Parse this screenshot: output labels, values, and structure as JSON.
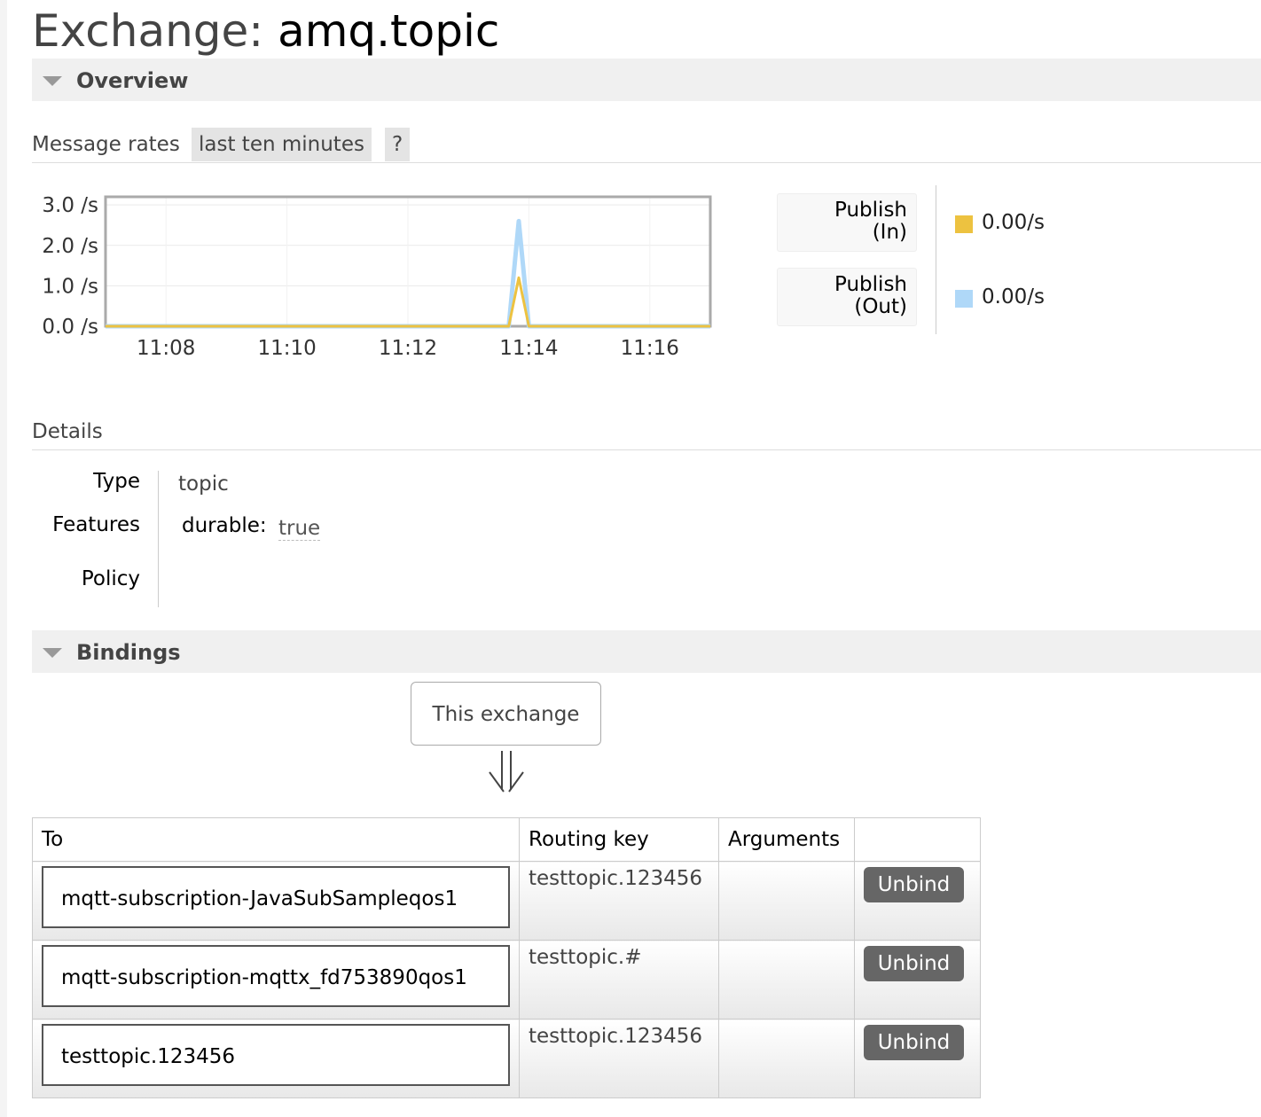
{
  "page": {
    "title_prefix": "Exchange:",
    "title_name": "amq.topic"
  },
  "overview": {
    "header": "Overview",
    "message_rates_label": "Message rates",
    "range_label": "last ten minutes",
    "help_label": "?"
  },
  "chart_data": {
    "type": "line",
    "x": [
      "11:07",
      "11:08",
      "11:09",
      "11:10",
      "11:11",
      "11:12",
      "11:13",
      "11:13:40",
      "11:13:50",
      "11:14:00",
      "11:15",
      "11:16",
      "11:17"
    ],
    "x_ticks": [
      "11:08",
      "11:10",
      "11:12",
      "11:14",
      "11:16"
    ],
    "y_ticks": [
      "3.0 /s",
      "2.0 /s",
      "1.0 /s",
      "0.0 /s"
    ],
    "ylim": [
      0,
      3.2
    ],
    "grid": true,
    "colors": {
      "publish_in": "#edc240",
      "publish_out": "#afd8f8"
    },
    "series": [
      {
        "name": "Publish (In)",
        "values": [
          0,
          0,
          0,
          0,
          0,
          0,
          0,
          0,
          1.2,
          0,
          0,
          0,
          0
        ]
      },
      {
        "name": "Publish (Out)",
        "values": [
          0,
          0,
          0,
          0,
          0,
          0,
          0,
          0,
          2.6,
          0,
          0,
          0,
          0
        ]
      }
    ]
  },
  "legend": [
    {
      "label_line1": "Publish",
      "label_line2": "(In)",
      "rate": "0.00/s",
      "color": "#edc240"
    },
    {
      "label_line1": "Publish",
      "label_line2": "(Out)",
      "rate": "0.00/s",
      "color": "#afd8f8"
    }
  ],
  "details": {
    "header": "Details",
    "type_label": "Type",
    "type_value": "topic",
    "features_label": "Features",
    "feature_key": "durable:",
    "feature_value": "true",
    "policy_label": "Policy"
  },
  "bindings": {
    "header": "Bindings",
    "this_exchange": "This exchange",
    "columns": [
      "To",
      "Routing key",
      "Arguments",
      ""
    ],
    "rows": [
      {
        "to": "mqtt-subscription-JavaSubSampleqos1",
        "routing_key": "testtopic.123456",
        "arguments": "",
        "action": "Unbind"
      },
      {
        "to": "mqtt-subscription-mqttx_fd753890qos1",
        "routing_key": "testtopic.#",
        "arguments": "",
        "action": "Unbind"
      },
      {
        "to": "testtopic.123456",
        "routing_key": "testtopic.123456",
        "arguments": "",
        "action": "Unbind"
      }
    ]
  }
}
